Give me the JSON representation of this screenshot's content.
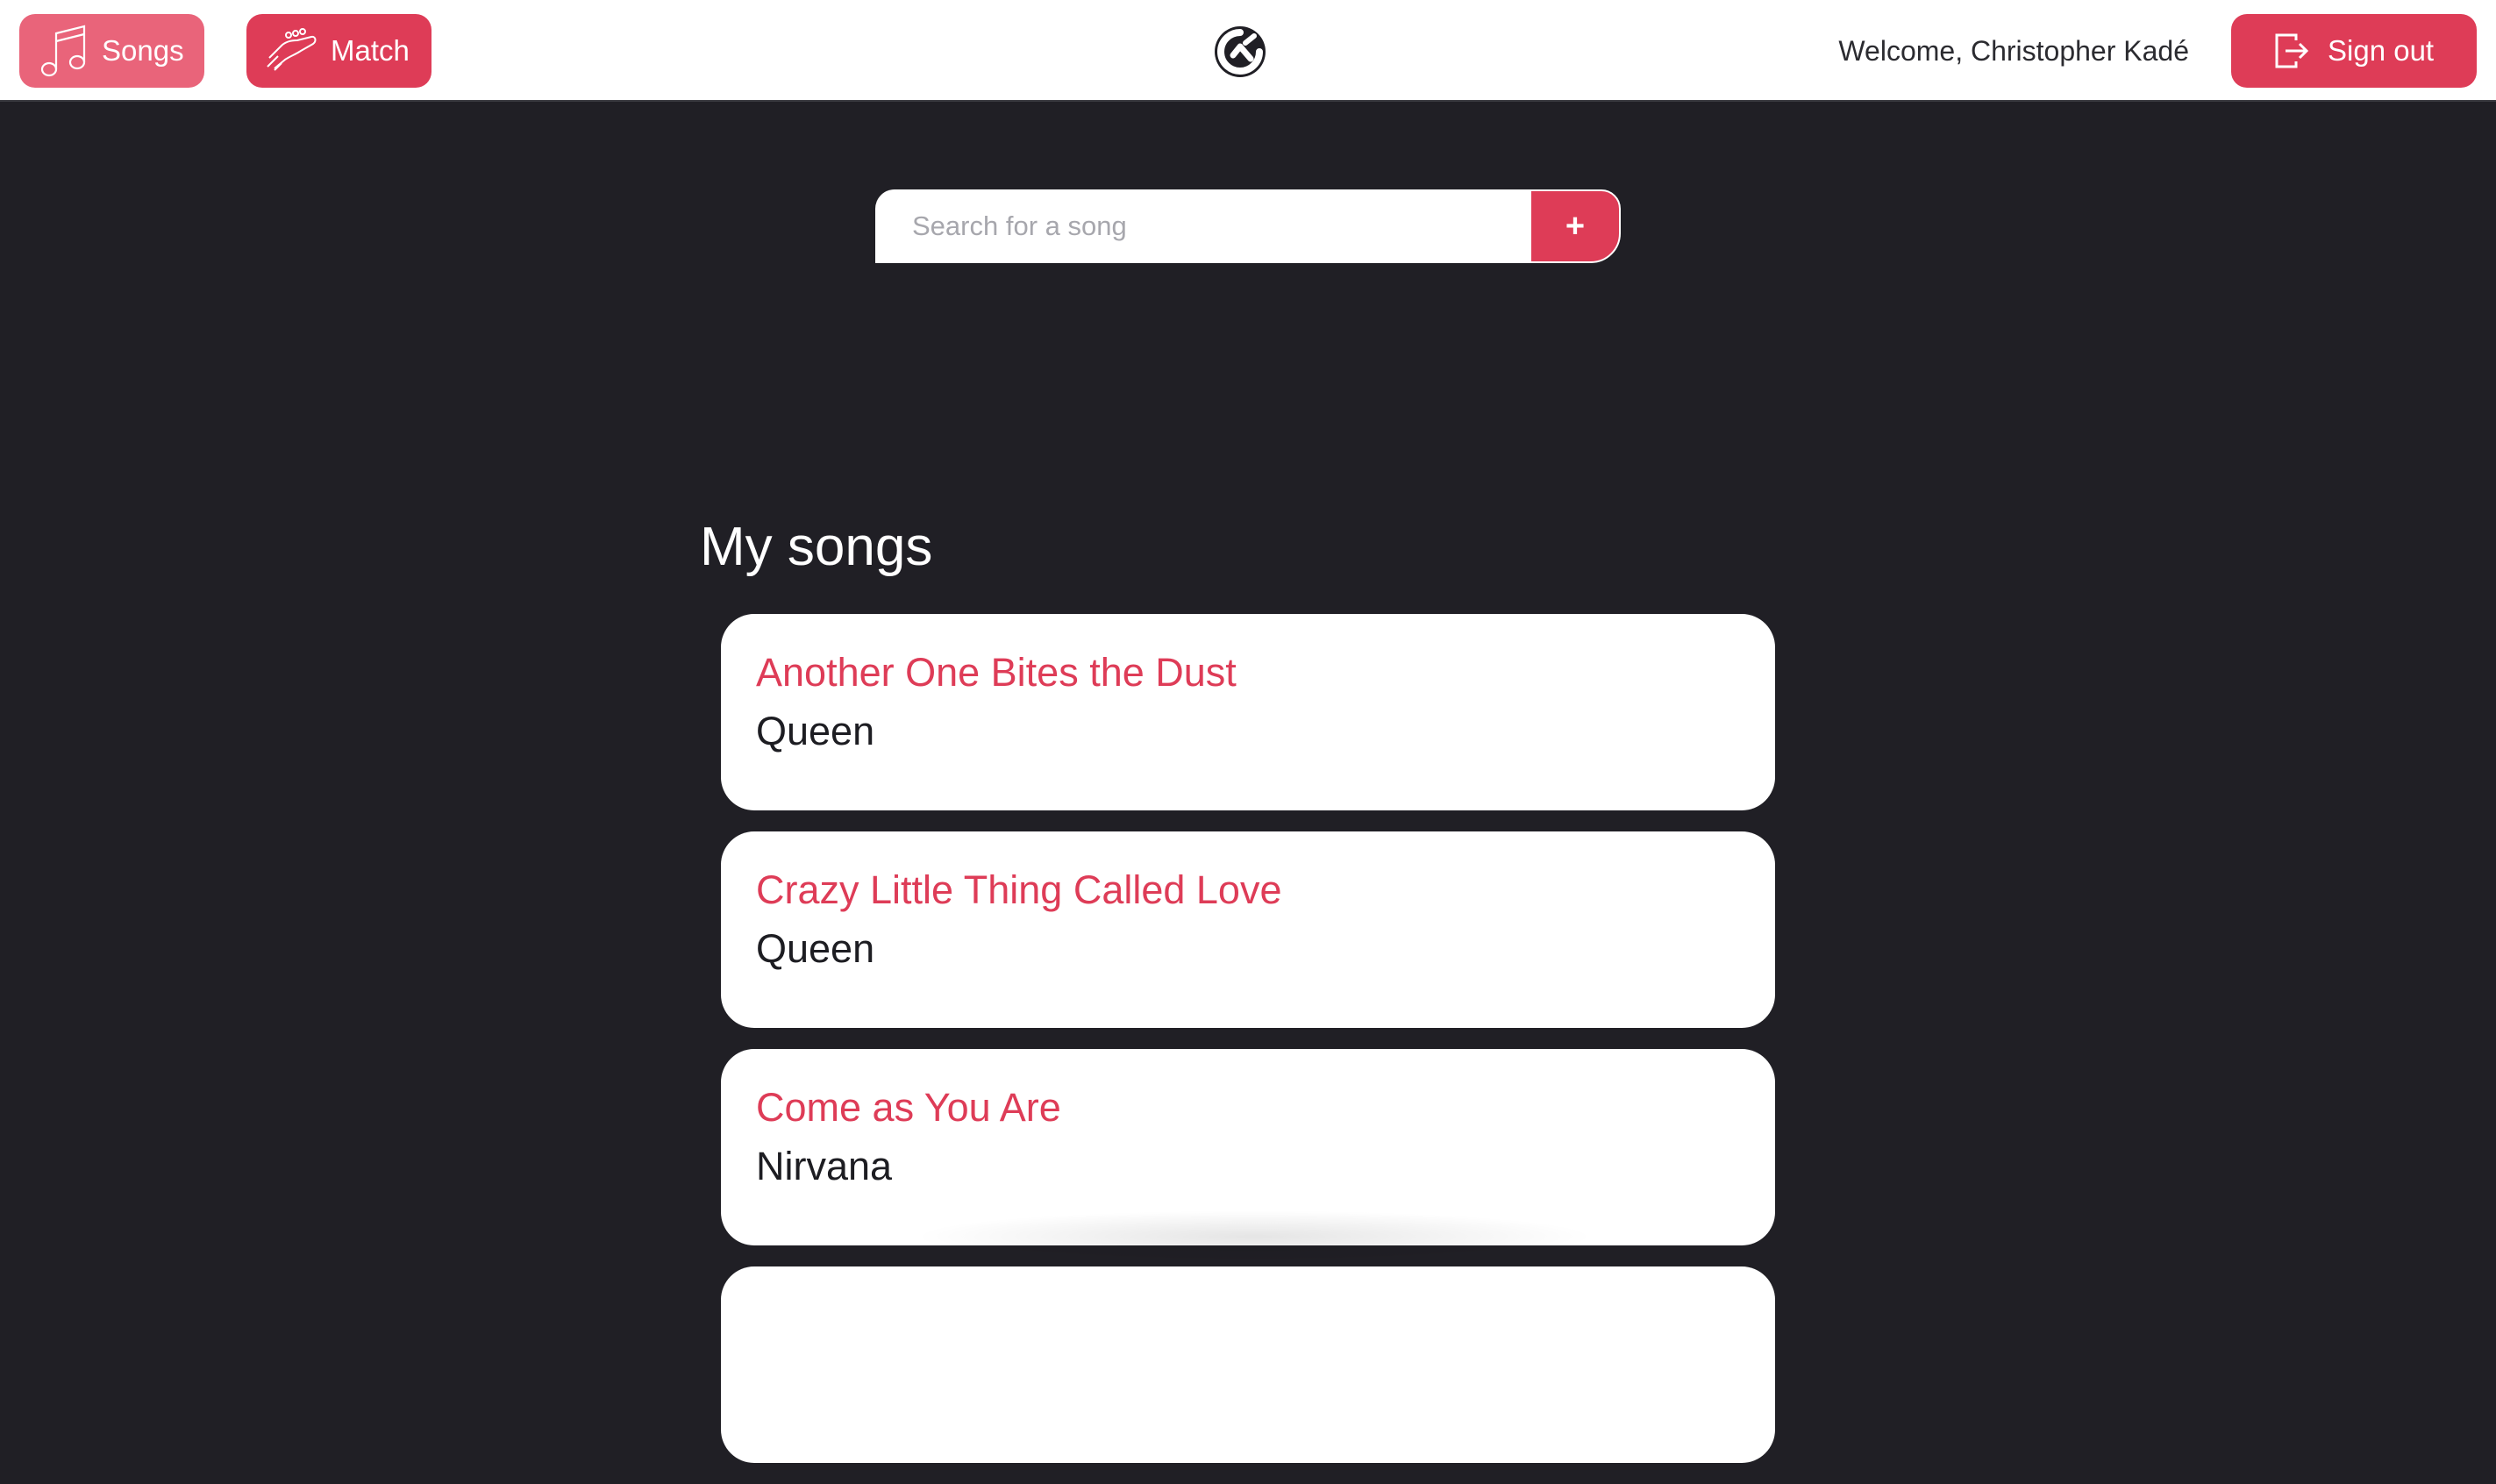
{
  "nav": {
    "songs_label": "Songs",
    "match_label": "Match",
    "welcome_text": "Welcome, Christopher Kadé",
    "signout_label": "Sign out"
  },
  "search": {
    "placeholder": "Search for a song",
    "value": "",
    "add_label": "+"
  },
  "songs_section": {
    "title": "My songs",
    "songs": [
      {
        "title": "Another One Bites the Dust",
        "artist": "Queen"
      },
      {
        "title": "Crazy Little Thing Called Love",
        "artist": "Queen"
      },
      {
        "title": "Come as You Are",
        "artist": "Nirvana"
      },
      {
        "title": "",
        "artist": ""
      }
    ]
  },
  "colors": {
    "accent": "#de3c57",
    "accent_light": "#e9647a",
    "background": "#201f25",
    "topbar": "#ffffff",
    "card": "#ffffff"
  },
  "icons": {
    "songs": "music-note-icon",
    "match": "guitar-headstock-icon",
    "logo": "app-logo-icon",
    "signout": "sign-out-icon"
  }
}
